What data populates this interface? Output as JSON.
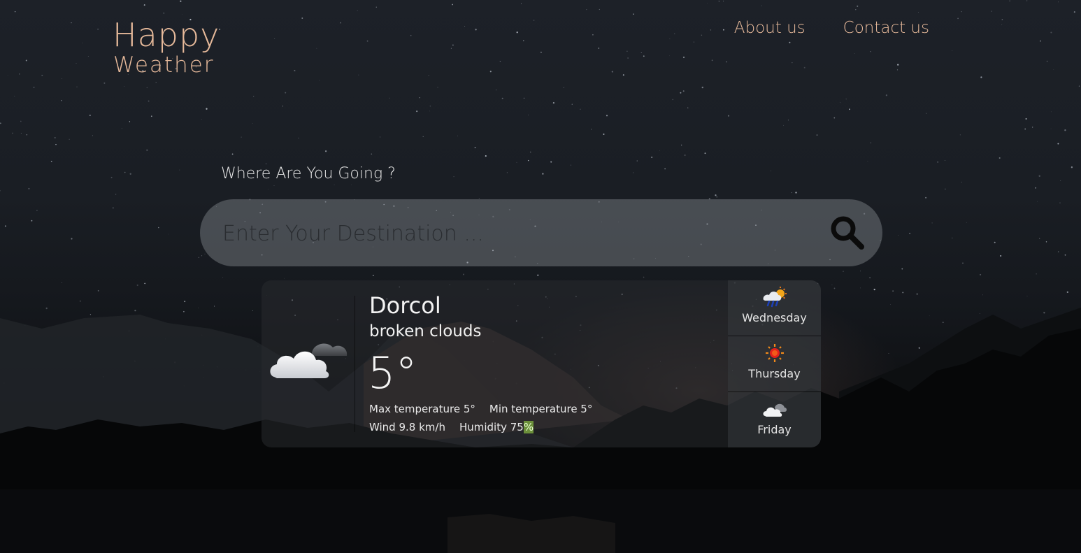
{
  "app": {
    "logo_line1": "Happy",
    "logo_line2": "Weather"
  },
  "nav": {
    "items": [
      {
        "label": "About us"
      },
      {
        "label": "Contact us"
      }
    ]
  },
  "search": {
    "prompt": "Where Are You Going ?",
    "placeholder": "Enter Your Destination ...",
    "value": "",
    "icon": "search-icon"
  },
  "weather": {
    "city": "Dorcol",
    "description": "broken clouds",
    "temperature": "5°",
    "max_label": "Max temperature 5°",
    "min_label": "Min temperature 5°",
    "wind_label": "Wind 9.8 km/h",
    "humidity_label": "Humidity 75",
    "humidity_unit": "%",
    "icon": "broken-clouds-icon"
  },
  "forecast": [
    {
      "day": "Wednesday",
      "icon": "rain-sun-icon"
    },
    {
      "day": "Thursday",
      "icon": "sun-icon"
    },
    {
      "day": "Friday",
      "icon": "cloud-sun-icon"
    }
  ],
  "colors": {
    "accent": "#e6b99a",
    "humidity_highlight": "#6b8f3a"
  }
}
